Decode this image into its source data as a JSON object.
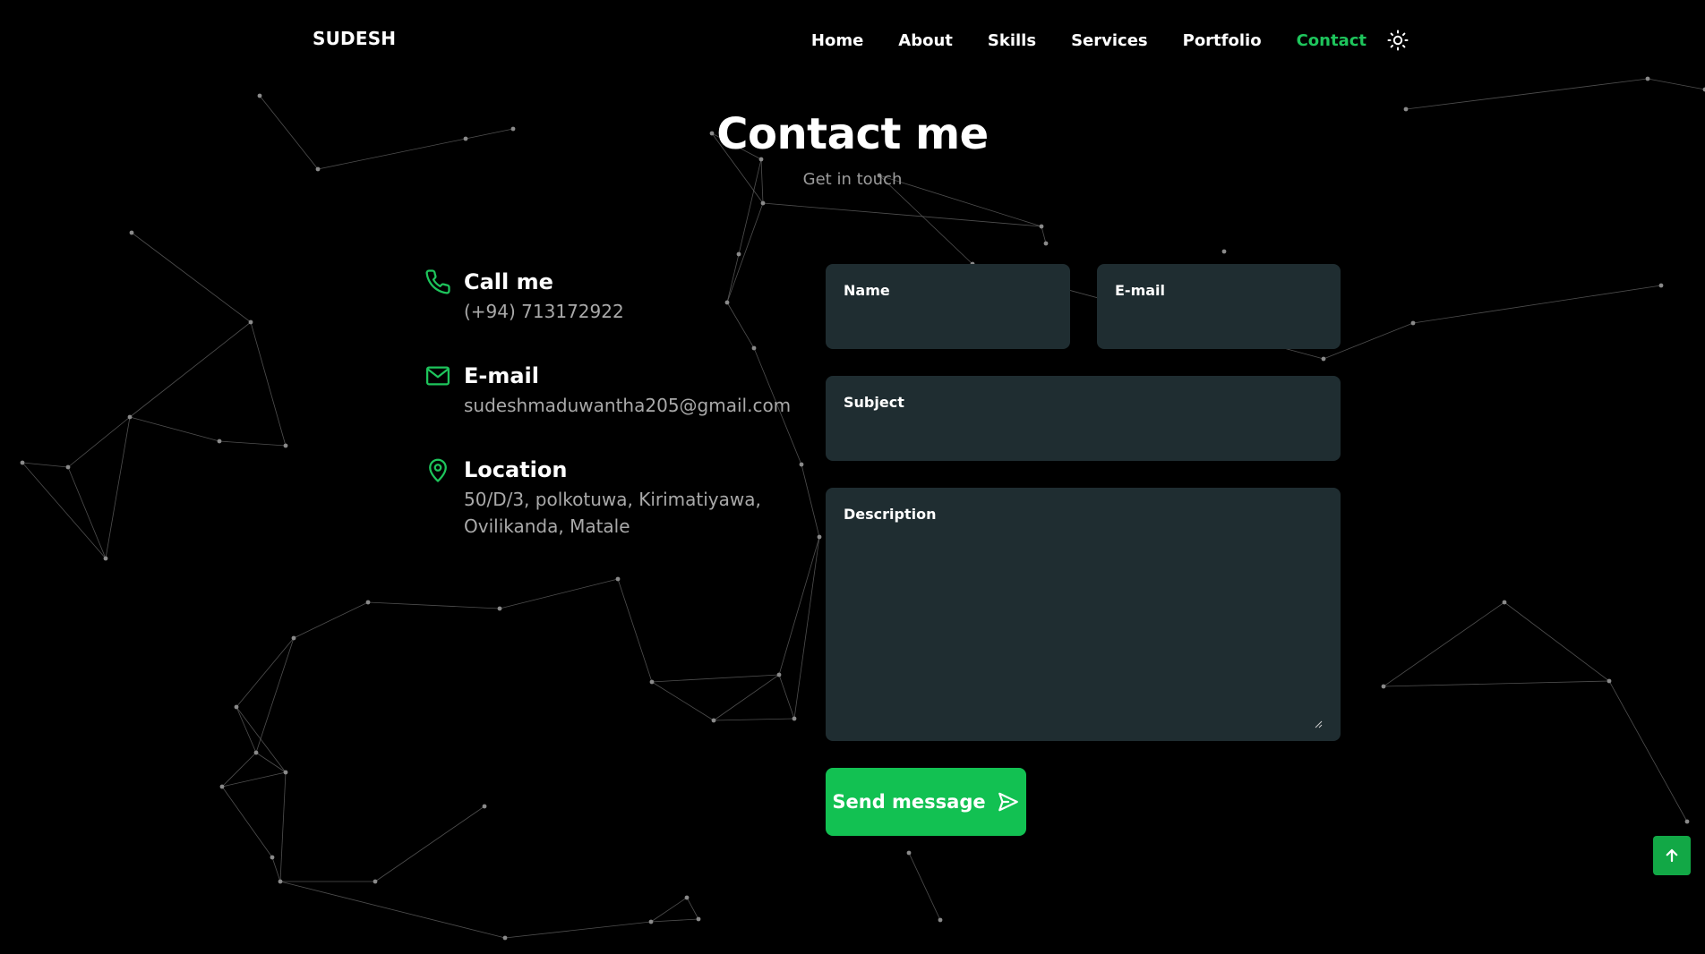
{
  "header": {
    "brand": "SUDESH",
    "nav": [
      {
        "label": "Home",
        "active": false
      },
      {
        "label": "About",
        "active": false
      },
      {
        "label": "Skills",
        "active": false
      },
      {
        "label": "Services",
        "active": false
      },
      {
        "label": "Portfolio",
        "active": false
      },
      {
        "label": "Contact",
        "active": true
      }
    ],
    "theme_toggle_icon": "sun-icon"
  },
  "section": {
    "title": "Contact me",
    "subtitle": "Get in touch"
  },
  "contact_info": [
    {
      "icon": "phone-icon",
      "title": "Call me",
      "value": "(+94) 713172922"
    },
    {
      "icon": "mail-icon",
      "title": "E-mail",
      "value": "sudeshmaduwantha205@gmail.com"
    },
    {
      "icon": "location-pin-icon",
      "title": "Location",
      "value_lines": [
        "50/D/3, polkotuwa, Kirimatiyawa,",
        "Ovilikanda, Matale"
      ]
    }
  ],
  "form": {
    "name_label": "Name",
    "name_value": "",
    "email_label": "E-mail",
    "email_value": "",
    "subject_label": "Subject",
    "subject_value": "",
    "description_label": "Description",
    "description_value": "",
    "send_label": "Send message",
    "send_icon": "send-icon"
  },
  "scroll_up_icon": "arrow-up-icon",
  "colors": {
    "background": "#000000",
    "accent": "#1ec55c",
    "button": "#12c152",
    "field_bg": "#1f2d31",
    "muted_text": "#a9a9a9"
  }
}
